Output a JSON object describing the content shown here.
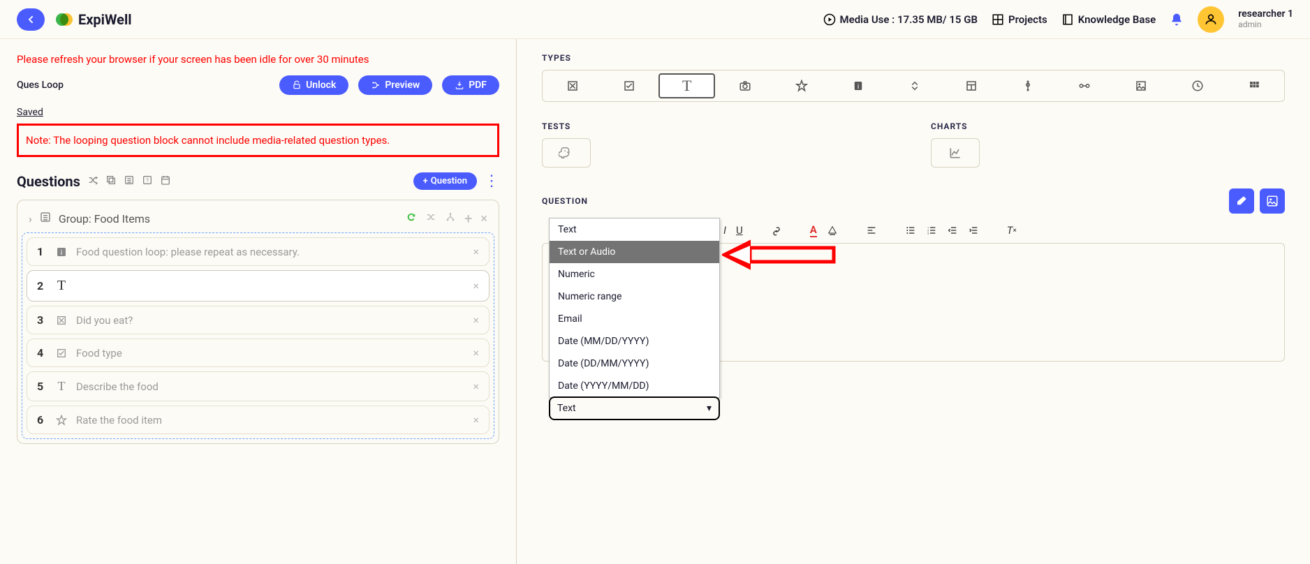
{
  "brand": {
    "name": "ExpiWell"
  },
  "topbar": {
    "media_use": "Media Use : 17.35 MB/ 15 GB",
    "projects": "Projects",
    "knowledge_base": "Knowledge Base",
    "user_name": "researcher 1",
    "user_role": "admin"
  },
  "left": {
    "refresh_warning": "Please refresh your browser if your screen has been idle for over 30 minutes",
    "ques_loop_label": "Ques Loop",
    "unlock": "Unlock",
    "preview": "Preview",
    "pdf": "PDF",
    "saved": "Saved",
    "note": "Note: The looping question block cannot include media-related question types.",
    "questions_title": "Questions",
    "add_question": "Question",
    "group_label": "Group: Food Items",
    "rows": [
      {
        "num": "1",
        "text": "Food question loop: please repeat as necessary."
      },
      {
        "num": "2",
        "text": ""
      },
      {
        "num": "3",
        "text": "Did you eat?"
      },
      {
        "num": "4",
        "text": "Food type"
      },
      {
        "num": "5",
        "text": "Describe the food"
      },
      {
        "num": "6",
        "text": "Rate the food item"
      }
    ]
  },
  "right": {
    "types_label": "TYPES",
    "tests_label": "TESTS",
    "charts_label": "CHARTS",
    "question_label": "QUESTION"
  },
  "dropdown": {
    "items": [
      "Text",
      "Text or Audio",
      "Numeric",
      "Numeric range",
      "Email",
      "Date (MM/DD/YYYY)",
      "Date (DD/MM/YYYY)",
      "Date (YYYY/MM/DD)"
    ],
    "selected_label": "Text"
  }
}
